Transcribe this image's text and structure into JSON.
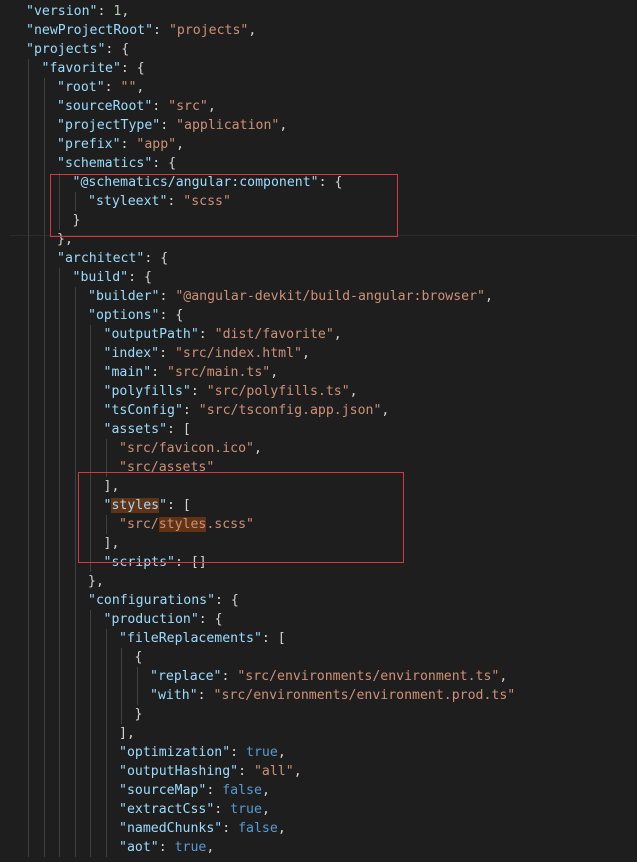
{
  "editor": {
    "lines": [
      {
        "i": 1,
        "parts": [
          {
            "t": "\"version\"",
            "c": "key"
          },
          {
            "t": ": "
          },
          {
            "t": "1",
            "c": "num"
          },
          {
            "t": ","
          }
        ]
      },
      {
        "i": 1,
        "parts": [
          {
            "t": "\"newProjectRoot\"",
            "c": "key"
          },
          {
            "t": ": "
          },
          {
            "t": "\"projects\"",
            "c": "str"
          },
          {
            "t": ","
          }
        ]
      },
      {
        "i": 1,
        "parts": [
          {
            "t": "\"projects\"",
            "c": "key"
          },
          {
            "t": ": {"
          }
        ]
      },
      {
        "i": 2,
        "parts": [
          {
            "t": "\"favorite\"",
            "c": "key"
          },
          {
            "t": ": {"
          }
        ]
      },
      {
        "i": 3,
        "parts": [
          {
            "t": "\"root\"",
            "c": "key"
          },
          {
            "t": ": "
          },
          {
            "t": "\"\"",
            "c": "str"
          },
          {
            "t": ","
          }
        ]
      },
      {
        "i": 3,
        "parts": [
          {
            "t": "\"sourceRoot\"",
            "c": "key"
          },
          {
            "t": ": "
          },
          {
            "t": "\"src\"",
            "c": "str"
          },
          {
            "t": ","
          }
        ]
      },
      {
        "i": 3,
        "parts": [
          {
            "t": "\"projectType\"",
            "c": "key"
          },
          {
            "t": ": "
          },
          {
            "t": "\"application\"",
            "c": "str"
          },
          {
            "t": ","
          }
        ]
      },
      {
        "i": 3,
        "parts": [
          {
            "t": "\"prefix\"",
            "c": "key"
          },
          {
            "t": ": "
          },
          {
            "t": "\"app\"",
            "c": "str"
          },
          {
            "t": ","
          }
        ]
      },
      {
        "i": 3,
        "parts": [
          {
            "t": "\"schematics\"",
            "c": "key"
          },
          {
            "t": ": {"
          }
        ]
      },
      {
        "i": 4,
        "parts": [
          {
            "t": "\"@schematics/angular:component\"",
            "c": "key"
          },
          {
            "t": ": {"
          }
        ]
      },
      {
        "i": 5,
        "parts": [
          {
            "t": "\"styleext\"",
            "c": "key"
          },
          {
            "t": ": "
          },
          {
            "t": "\"scss\"",
            "c": "str"
          }
        ]
      },
      {
        "i": 4,
        "parts": [
          {
            "t": "}"
          }
        ]
      },
      {
        "i": 3,
        "parts": [
          {
            "t": "},"
          }
        ]
      },
      {
        "i": 3,
        "parts": [
          {
            "t": "\"architect\"",
            "c": "key"
          },
          {
            "t": ": {"
          }
        ]
      },
      {
        "i": 4,
        "parts": [
          {
            "t": "\"build\"",
            "c": "key"
          },
          {
            "t": ": {"
          }
        ]
      },
      {
        "i": 5,
        "parts": [
          {
            "t": "\"builder\"",
            "c": "key"
          },
          {
            "t": ": "
          },
          {
            "t": "\"@angular-devkit/build-angular:browser\"",
            "c": "str"
          },
          {
            "t": ","
          }
        ]
      },
      {
        "i": 5,
        "parts": [
          {
            "t": "\"options\"",
            "c": "key"
          },
          {
            "t": ": {"
          }
        ]
      },
      {
        "i": 6,
        "parts": [
          {
            "t": "\"outputPath\"",
            "c": "key"
          },
          {
            "t": ": "
          },
          {
            "t": "\"dist/favorite\"",
            "c": "str"
          },
          {
            "t": ","
          }
        ]
      },
      {
        "i": 6,
        "parts": [
          {
            "t": "\"index\"",
            "c": "key"
          },
          {
            "t": ": "
          },
          {
            "t": "\"src/index.html\"",
            "c": "str"
          },
          {
            "t": ","
          }
        ]
      },
      {
        "i": 6,
        "parts": [
          {
            "t": "\"main\"",
            "c": "key"
          },
          {
            "t": ": "
          },
          {
            "t": "\"src/main.ts\"",
            "c": "str"
          },
          {
            "t": ","
          }
        ]
      },
      {
        "i": 6,
        "parts": [
          {
            "t": "\"polyfills\"",
            "c": "key"
          },
          {
            "t": ": "
          },
          {
            "t": "\"src/polyfills.ts\"",
            "c": "str"
          },
          {
            "t": ","
          }
        ]
      },
      {
        "i": 6,
        "parts": [
          {
            "t": "\"tsConfig\"",
            "c": "key"
          },
          {
            "t": ": "
          },
          {
            "t": "\"src/tsconfig.app.json\"",
            "c": "str"
          },
          {
            "t": ","
          }
        ]
      },
      {
        "i": 6,
        "parts": [
          {
            "t": "\"assets\"",
            "c": "key"
          },
          {
            "t": ": ["
          }
        ]
      },
      {
        "i": 7,
        "parts": [
          {
            "t": "\"src/favicon.ico\"",
            "c": "str"
          },
          {
            "t": ","
          }
        ]
      },
      {
        "i": 7,
        "parts": [
          {
            "t": "\"src/assets\"",
            "c": "str"
          }
        ]
      },
      {
        "i": 6,
        "parts": [
          {
            "t": "],"
          }
        ]
      },
      {
        "i": 6,
        "parts": [
          {
            "t": "\"",
            "c": "key"
          },
          {
            "t": "styles",
            "c": "key hl"
          },
          {
            "t": "\"",
            "c": "key"
          },
          {
            "t": ": ["
          }
        ]
      },
      {
        "i": 7,
        "parts": [
          {
            "t": "\"src/",
            "c": "str"
          },
          {
            "t": "styles",
            "c": "str hl"
          },
          {
            "t": ".scss\"",
            "c": "str"
          }
        ]
      },
      {
        "i": 6,
        "parts": [
          {
            "t": "],"
          }
        ]
      },
      {
        "i": 6,
        "parts": [
          {
            "t": "\"scripts\"",
            "c": "key"
          },
          {
            "t": ": []"
          }
        ]
      },
      {
        "i": 5,
        "parts": [
          {
            "t": "},"
          }
        ]
      },
      {
        "i": 5,
        "parts": [
          {
            "t": "\"configurations\"",
            "c": "key"
          },
          {
            "t": ": {"
          }
        ]
      },
      {
        "i": 6,
        "parts": [
          {
            "t": "\"production\"",
            "c": "key"
          },
          {
            "t": ": {"
          }
        ]
      },
      {
        "i": 7,
        "parts": [
          {
            "t": "\"fileReplacements\"",
            "c": "key"
          },
          {
            "t": ": ["
          }
        ]
      },
      {
        "i": 8,
        "parts": [
          {
            "t": "{"
          }
        ]
      },
      {
        "i": 9,
        "parts": [
          {
            "t": "\"replace\"",
            "c": "key"
          },
          {
            "t": ": "
          },
          {
            "t": "\"src/environments/environment.ts\"",
            "c": "str"
          },
          {
            "t": ","
          }
        ]
      },
      {
        "i": 9,
        "parts": [
          {
            "t": "\"with\"",
            "c": "key"
          },
          {
            "t": ": "
          },
          {
            "t": "\"src/environments/environment.prod.ts\"",
            "c": "str"
          }
        ]
      },
      {
        "i": 8,
        "parts": [
          {
            "t": "}"
          }
        ]
      },
      {
        "i": 7,
        "parts": [
          {
            "t": "],"
          }
        ]
      },
      {
        "i": 7,
        "parts": [
          {
            "t": "\"optimization\"",
            "c": "key"
          },
          {
            "t": ": "
          },
          {
            "t": "true",
            "c": "bool"
          },
          {
            "t": ","
          }
        ]
      },
      {
        "i": 7,
        "parts": [
          {
            "t": "\"outputHashing\"",
            "c": "key"
          },
          {
            "t": ": "
          },
          {
            "t": "\"all\"",
            "c": "str"
          },
          {
            "t": ","
          }
        ]
      },
      {
        "i": 7,
        "parts": [
          {
            "t": "\"sourceMap\"",
            "c": "key"
          },
          {
            "t": ": "
          },
          {
            "t": "false",
            "c": "bool"
          },
          {
            "t": ","
          }
        ]
      },
      {
        "i": 7,
        "parts": [
          {
            "t": "\"extractCss\"",
            "c": "key"
          },
          {
            "t": ": "
          },
          {
            "t": "true",
            "c": "bool"
          },
          {
            "t": ","
          }
        ]
      },
      {
        "i": 7,
        "parts": [
          {
            "t": "\"namedChunks\"",
            "c": "key"
          },
          {
            "t": ": "
          },
          {
            "t": "false",
            "c": "bool"
          },
          {
            "t": ","
          }
        ]
      },
      {
        "i": 7,
        "parts": [
          {
            "t": "\"aot\"",
            "c": "key"
          },
          {
            "t": ": "
          },
          {
            "t": "true",
            "c": "bool"
          },
          {
            "t": ","
          }
        ]
      }
    ]
  },
  "colors": {
    "background": "#1e1e1e",
    "key": "#9cdcfe",
    "string": "#ce9178",
    "number": "#b5cea8",
    "boolean": "#569cd6",
    "punctuation": "#d4d4d4",
    "highlight": "#613214",
    "callout_border": "#d9373f"
  }
}
